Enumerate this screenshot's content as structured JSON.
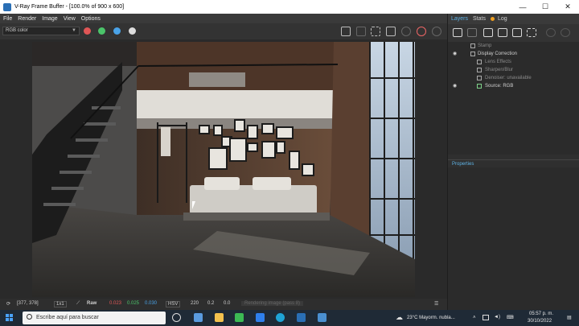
{
  "window": {
    "title": "V-Ray Frame Buffer - [100.0% of 900 x 600]",
    "controls": {
      "minimize": "—",
      "maximize": "☐",
      "close": "✕"
    }
  },
  "menu": [
    "File",
    "Render",
    "Image",
    "View",
    "Options"
  ],
  "toolbar": {
    "channel_select": "RGB color",
    "channel_colors": {
      "red": "#e05656",
      "green": "#4bc46a",
      "blue": "#4aa3e8"
    }
  },
  "status": {
    "coords": "[377, 378]",
    "zoom": "1x1",
    "mode": "Raw",
    "r": "0.023",
    "g": "0.025",
    "b": "0.030",
    "color_space": "HSV",
    "h": "220",
    "s": "0.2",
    "v": "0.0",
    "progress_text": "Rendering image (pass 8)"
  },
  "panel": {
    "tabs": [
      "Layers",
      "Stats",
      "Log"
    ],
    "active_tab": "Layers",
    "layers": [
      {
        "label": "Stamp",
        "visible": false,
        "indent": 1,
        "dim": true
      },
      {
        "label": "Display Correction",
        "visible": true,
        "indent": 1,
        "dim": false
      },
      {
        "label": "Lens Effects",
        "visible": false,
        "indent": 2,
        "dim": true
      },
      {
        "label": "Sharpen/Blur",
        "visible": false,
        "indent": 2,
        "dim": true
      },
      {
        "label": "Denoiser: unavailable",
        "visible": false,
        "indent": 2,
        "dim": true
      },
      {
        "label": "Source: RGB",
        "visible": true,
        "indent": 2,
        "dim": false
      }
    ],
    "properties_title": "Properties"
  },
  "taskbar": {
    "search_placeholder": "Escribe aquí para buscar",
    "weather": "23°C  Mayorm. nubla...",
    "time": "05:57 p. m.",
    "date": "30/10/2022"
  }
}
